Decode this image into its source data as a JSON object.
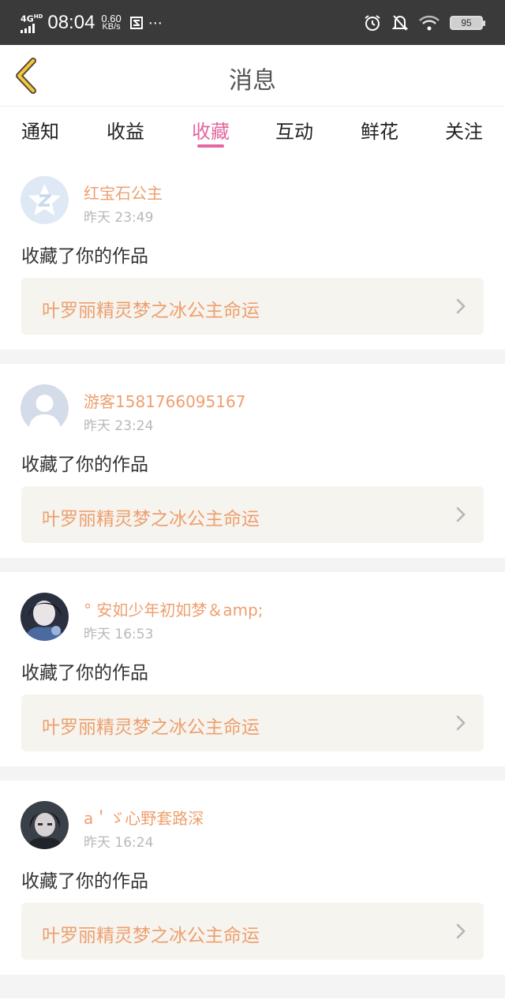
{
  "status_bar": {
    "network": "4G",
    "network_sup": "HD",
    "time": "08:04",
    "speed_value": "0.60",
    "speed_unit": "KB/s",
    "extra": "⋯",
    "battery": "95"
  },
  "header": {
    "title": "消息",
    "back_icon": "chevron-left-icon"
  },
  "tabs": [
    {
      "label": "通知",
      "active": false
    },
    {
      "label": "收益",
      "active": false
    },
    {
      "label": "收藏",
      "active": true
    },
    {
      "label": "互动",
      "active": false
    },
    {
      "label": "鲜花",
      "active": false
    },
    {
      "label": "关注",
      "active": false
    }
  ],
  "colors": {
    "accent_pink": "#e5679f",
    "name_orange": "#ee9f6e",
    "box_bg": "#f5f4ef"
  },
  "feed": [
    {
      "username": "红宝石公主",
      "time": "昨天 23:49",
      "action": "收藏了你的作品",
      "work_title": "叶罗丽精灵梦之冰公主命运",
      "avatar": "qq-default-avatar"
    },
    {
      "username": "游客1581766095167",
      "time": "昨天 23:24",
      "action": "收藏了你的作品",
      "work_title": "叶罗丽精灵梦之冰公主命运",
      "avatar": "default-person-avatar"
    },
    {
      "username": "° 安如少年初如梦＆amp;",
      "time": "昨天 16:53",
      "action": "收藏了你的作品",
      "work_title": "叶罗丽精灵梦之冰公主命运",
      "avatar": "photo-avatar"
    },
    {
      "username": "a＇ゞ心野套路深",
      "time": "昨天 16:24",
      "action": "收藏了你的作品",
      "work_title": "叶罗丽精灵梦之冰公主命运",
      "avatar": "photo-avatar"
    }
  ]
}
